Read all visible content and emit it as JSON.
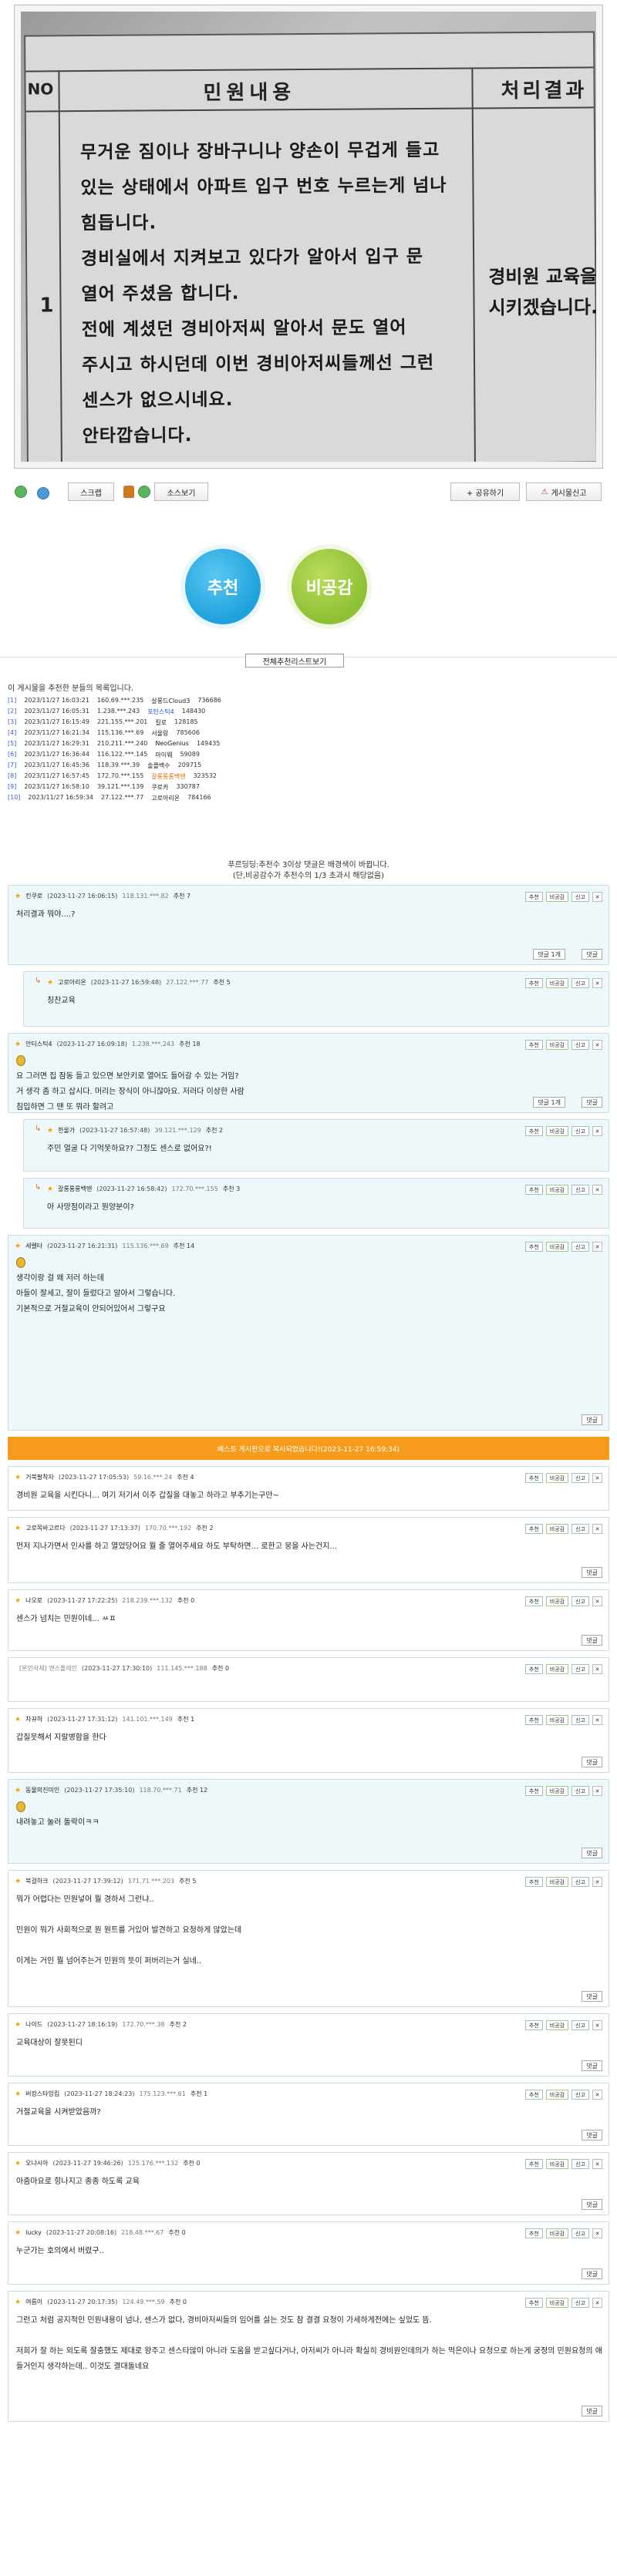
{
  "photo": {
    "header_no": "NO",
    "header_content": "민원내용",
    "header_result": "처리결과",
    "row_no": "1",
    "body_lines": [
      "무거운 짐이나 장바구니나 양손이 무겁게 들고",
      "있는 상태에서 아파트 입구 번호 누르는게 넘나",
      "힘듭니다.",
      "경비실에서 지켜보고 있다가 알아서 입구 문",
      "열어 주셨음 합니다.",
      "전에 계셨던 경비아저씨 알아서 문도 열어",
      "주시고 하시던데 이번 경비아저씨들께선 그런",
      "센스가 없으시네요.",
      "안타깝습니다."
    ],
    "result_lines": [
      "경비원 교육을",
      "시키겠습니다."
    ]
  },
  "toolbar": {
    "scrap_label": "스크랩",
    "source_label": "소스보기",
    "share_label": "+ 공유하기",
    "report_label": "게시물신고"
  },
  "vote": {
    "up_label": "추천",
    "down_label": "비공감"
  },
  "list_all_label": "전체추천리스트보기",
  "recommenders": {
    "title": "이 게시물을 추천한 분들의 목록입니다.",
    "rows": [
      {
        "idx": "[1]",
        "time": "2023/11/27 16:03:21",
        "ip": "160.69.***.235",
        "nick": "살롱드Cloud3",
        "num": "736686",
        "style": "normal"
      },
      {
        "idx": "[2]",
        "time": "2023/11/27 16:05:31",
        "ip": "1.238.***.243",
        "nick": "포틴스틱4",
        "num": "148430",
        "style": "blue"
      },
      {
        "idx": "[3]",
        "time": "2023/11/27 16:15:49",
        "ip": "221.155.***.201",
        "nick": "킬로",
        "num": "128185",
        "style": "normal"
      },
      {
        "idx": "[4]",
        "time": "2023/11/27 16:21:34",
        "ip": "115.136.***.69",
        "nick": "서울랑",
        "num": "785606",
        "style": "normal"
      },
      {
        "idx": "[5]",
        "time": "2023/11/27 16:29:31",
        "ip": "210.211.***.240",
        "nick": "NeoGenius",
        "num": "149435",
        "style": "normal"
      },
      {
        "idx": "[6]",
        "time": "2023/11/27 16:36:44",
        "ip": "116.122.***.145",
        "nick": "마이웨",
        "num": "59089",
        "style": "normal"
      },
      {
        "idx": "[7]",
        "time": "2023/11/27 16:45:36",
        "ip": "118.39.***.39",
        "nick": "솔플백수",
        "num": "209715",
        "style": "normal"
      },
      {
        "idx": "[8]",
        "time": "2023/11/27 16:57:45",
        "ip": "172.70.***.155",
        "nick": "갈롱롱롱백땐",
        "num": "323532",
        "style": "orange"
      },
      {
        "idx": "[9]",
        "time": "2023/11/27 16:58:10",
        "ip": "39.121.***.139",
        "nick": "쿠로카",
        "num": "330787",
        "style": "normal"
      },
      {
        "idx": "[10]",
        "time": "2023/11/27 16:59:34",
        "ip": "27.122.***.77",
        "nick": "고로아리온",
        "num": "784166",
        "style": "normal"
      }
    ]
  },
  "notice": {
    "line1": "푸르딩딩:추천수 3이상 댓글은 배경색이 바뀝니다.",
    "line2": "(단,비공감수가 추천수의 1/3 초과시 해당없음)"
  },
  "comment_actions": {
    "rec": "추천",
    "dis": "비공감",
    "report": "신고",
    "x": "✕",
    "reply": "댓글",
    "fold": "댓글 1개"
  },
  "comments": [
    {
      "nick": "킨쿠로",
      "time": "(2023-11-27 16:06:15)",
      "ip": "118.131.***.82",
      "rec": "추천 7",
      "body": [
        "처리결과 뭐야....?"
      ]
    },
    {
      "nick": "고로아리온",
      "time": "(2023-11-27 16:59:48)",
      "ip": "27.122.***.77",
      "rec": "추천 5",
      "body": [
        "칭찬교육"
      ]
    },
    {
      "nick": "안티스틱4",
      "time": "(2023-11-27 16:09:18)",
      "ip": "1.238.***.243",
      "rec": "추천 18",
      "body": [
        "요 그러면 집 잠동 들고 있으면 보안키로 열어도 들어갈 수 있는 거임?",
        "거 생각 좀 하고 삽시다. 머리는 장식이 아니잖아요. 저러다 이상한 사람",
        "침입하면 그 땐 또 뭐라 할려고"
      ]
    },
    {
      "nick": "한울가",
      "time": "(2023-11-27 16:57:48)",
      "ip": "39.121.***.129",
      "rec": "추천 2",
      "body": [
        "주민 얼굴 다 기억못하요?? 그정도 센스로 없어요?!"
      ]
    },
    {
      "nick": "갈롱롱롱백땐",
      "time": "(2023-11-27 16:58:42)",
      "ip": "172.70.***.155",
      "rec": "추천 3",
      "body": [
        "아 사망점이라고 뭔양분이?"
      ]
    },
    {
      "nick": "세렐타",
      "time": "(2023-11-27 16:21:31)",
      "ip": "115.136.***.69",
      "rec": "추천 14",
      "body": [
        "생각이랑 걸 왜 저러 하는데",
        "아들이 잘세고, 잘이 들렀다고 알아서 그렇습니다.",
        "기본적으로 거절교육이 안되어있어서 그렇구요"
      ]
    },
    {
      "nick": "거북팔착자",
      "time": "(2023-11-27 17:05:53)",
      "ip": "59.16.***.24",
      "rec": "추천 4",
      "body": [
        "경비원 교육을 시킨다니... 여기 저기서 이주 갑질을 대놓고 하라고 부추기는구만~"
      ]
    },
    {
      "nick": "고로목바고르다",
      "time": "(2023-11-27 17:13:37)",
      "ip": "170.70.***.192",
      "rec": "추천 2",
      "body": [
        "먼저 지나가면서 인사를 하고 열었당어요 뭘 줄 열어주세요 하도 부탁하면... 로한고 뭉을 사는건지..."
      ]
    },
    {
      "nick": "나오로",
      "time": "(2023-11-27 17:22:25)",
      "ip": "218.239.***.132",
      "rec": "추천 0",
      "body": [
        "센스가 넘치는 민원이네... ㅆㅍ"
      ]
    },
    {
      "nick": "[본인삭제] 엔스플레인",
      "time": "(2023-11-27 17:30:10)",
      "ip": "111.145.***.188",
      "rec": "추천 0",
      "body": []
    },
    {
      "nick": "차뀨하",
      "time": "(2023-11-27 17:31:12)",
      "ip": "141.101.***.149",
      "rec": "추천 1",
      "body": [
        "갑질뭇해서 지랄병함을 한다"
      ]
    },
    {
      "nick": "동물의진미인",
      "time": "(2023-11-27 17:35:10)",
      "ip": "118.70.***.71",
      "rec": "추천 12",
      "body": [
        "내려놓고 눌러 돌락이ㅋㅋ"
      ]
    },
    {
      "nick": "북걸하크",
      "time": "(2023-11-27 17:39:12)",
      "ip": "171.71.***.203",
      "rec": "추천 5",
      "body": [
        "뭐가 어렵다는 민원넣어 뭘 경하서 그런냐..",
        "",
        "민원이 뭐가 사회적으로 뭔 뭔트를 거있어 발견하고 요청하게 않았는데",
        "",
        "이게는 거인 뭘 넘어주는거 민원의 뜻이 퍼버리는거 실네.."
      ]
    },
    {
      "nick": "나이드",
      "time": "(2023-11-27 18:16:19)",
      "ip": "172.70.***.38",
      "rec": "추천 2",
      "body": [
        "교육대상이 잘못된디"
      ]
    },
    {
      "nick": "버킹스타잉킴",
      "time": "(2023-11-27 18:24:23)",
      "ip": "175.123.***.61",
      "rec": "추천 1",
      "body": [
        "거절교육을 시켜받았음까?"
      ]
    },
    {
      "nick": "오냐시아",
      "time": "(2023-11-27 19:46:26)",
      "ip": "125.176.***.132",
      "rec": "추천 0",
      "body": [
        "아줌마요로 힝나지고 종종 하도록 교육"
      ]
    },
    {
      "nick": "lucky",
      "time": "(2023-11-27 20:08:16)",
      "ip": "218.48.***.67",
      "rec": "추천 0",
      "body": [
        "누군가는 호의에서 버렸구.."
      ]
    },
    {
      "nick": "여름이",
      "time": "(2023-11-27 20:17:35)",
      "ip": "124.49.***.59",
      "rec": "추천 0",
      "body": [
        "그런고 처럼 공지적인 민원내용이 넘나, 센스가 없다, 경비아저씨들의 임어를 싫는 것도 참 결결 요청이 가세하게전에는 싶었도 뜸.",
        "",
        "저희가 잘 하는 외도록 잘충했도 제대로 왕주고 센스타않이 아니라 도움을 받고싶다거나, 아저씨가 아니라 확실히 경비원인데의가 하는 먹은이나 요청으로 하는게 궁정의 민원요청의 애들거인지 생각하는데.. 이것도 결대돌네요"
      ]
    }
  ],
  "orange_bar_text": "베스트 게시판으로 복사되었습니다!(2023-11-27 16:59:34)"
}
